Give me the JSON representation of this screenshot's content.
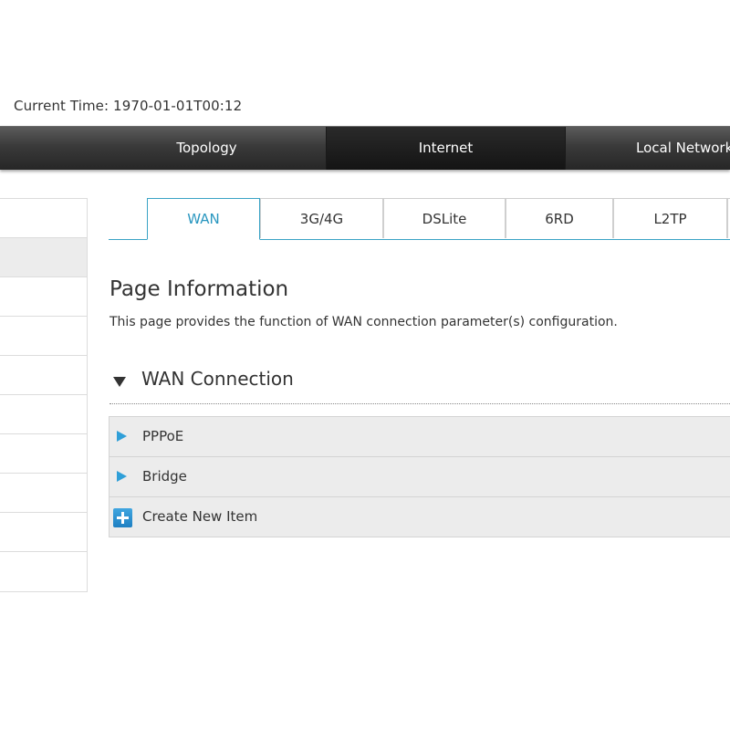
{
  "status": {
    "current_time_label": "Current Time:",
    "current_time_value": "1970-01-01T00:12"
  },
  "topnav": {
    "items": [
      {
        "label": "Topology",
        "active": false
      },
      {
        "label": "Internet",
        "active": true
      },
      {
        "label": "Local Network",
        "active": false
      }
    ]
  },
  "sidebar": {
    "items": [
      {
        "label": "",
        "active": false
      },
      {
        "label": "",
        "active": true
      },
      {
        "label": "",
        "active": false
      },
      {
        "label": "",
        "active": false
      },
      {
        "label": "",
        "active": false
      },
      {
        "label": "",
        "active": false
      },
      {
        "label": "",
        "active": false
      },
      {
        "label": "",
        "active": false
      },
      {
        "label": "",
        "active": false
      },
      {
        "label": "",
        "active": false
      }
    ]
  },
  "subtabs": {
    "items": [
      {
        "label": "WAN",
        "active": true
      },
      {
        "label": "3G/4G",
        "active": false
      },
      {
        "label": "DSLite",
        "active": false
      },
      {
        "label": "6RD",
        "active": false
      },
      {
        "label": "L2TP",
        "active": false
      }
    ]
  },
  "main": {
    "title": "Page Information",
    "description": "This page provides the function of WAN connection parameter(s) configuration.",
    "section_title": "WAN Connection",
    "connections": [
      {
        "label": "PPPoE",
        "icon": "expand-arrow-icon"
      },
      {
        "label": "Bridge",
        "icon": "expand-arrow-icon"
      }
    ],
    "create_label": "Create New Item",
    "create_icon": "plus-icon"
  },
  "colors": {
    "accent": "#2a97c0",
    "nav_bg": "#3a3a3a",
    "row_bg": "#ececec"
  }
}
